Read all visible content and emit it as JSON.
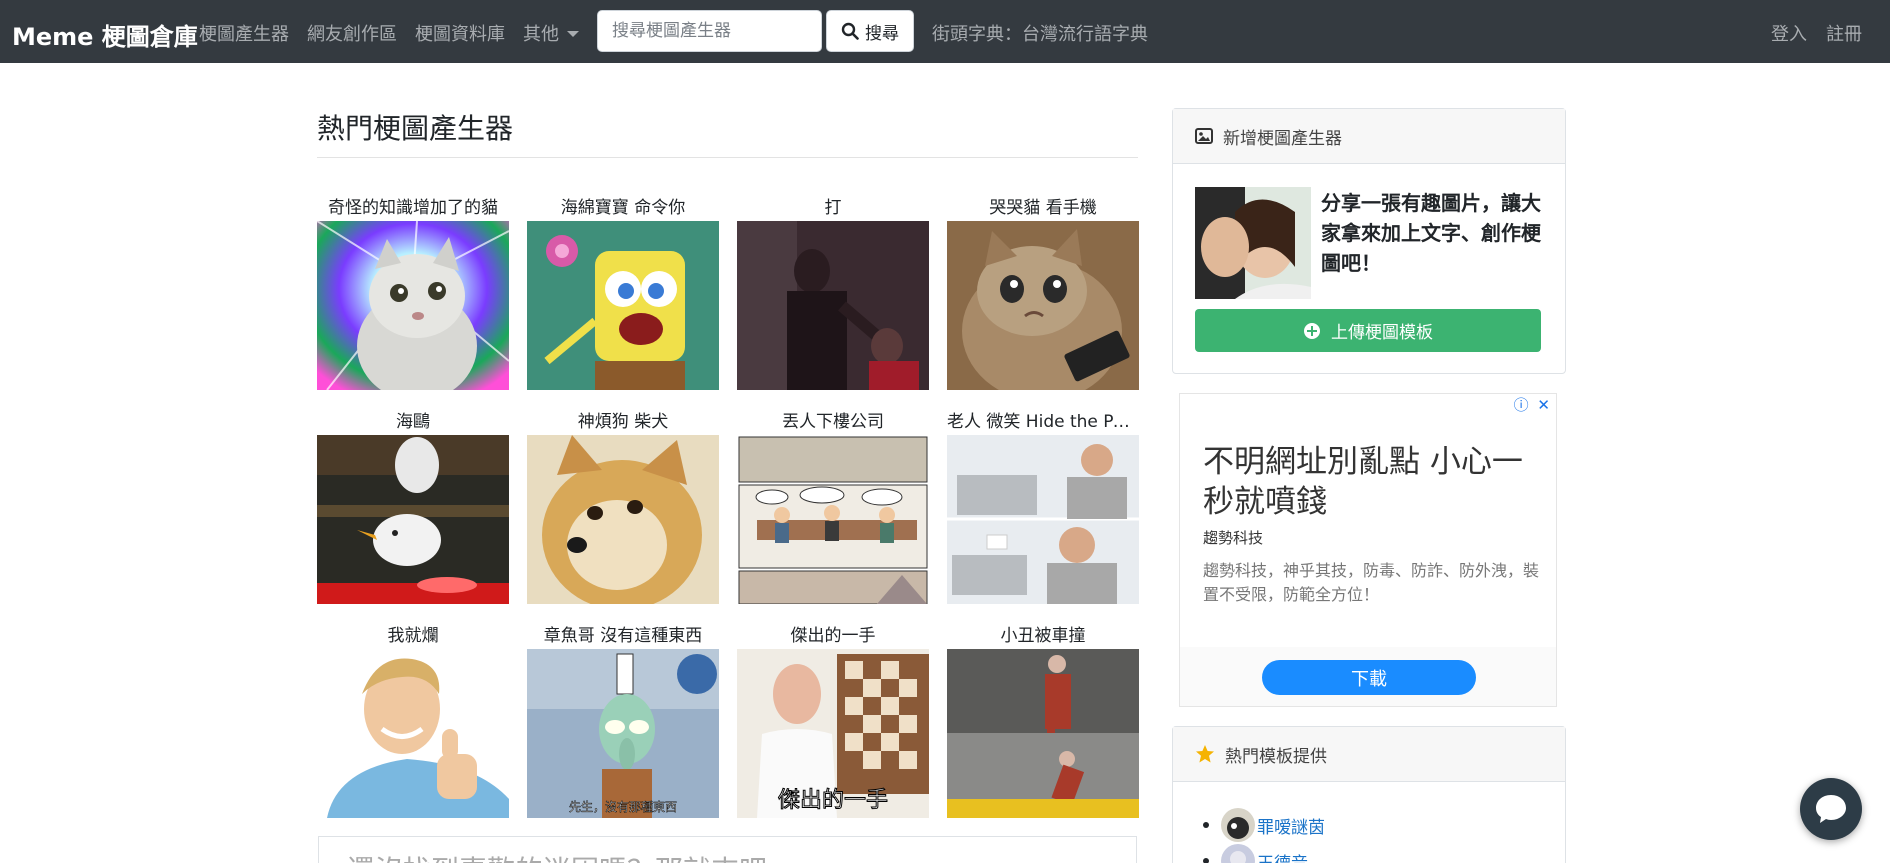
{
  "navbar": {
    "brand": "Meme 梗圖倉庫",
    "links": [
      "梗圖產生器",
      "網友創作區",
      "梗圖資料庫"
    ],
    "dropdown_label": "其他",
    "search_placeholder": "搜尋梗圖產生器",
    "search_button": "搜尋",
    "dictionary_link": "街頭字典：台灣流行語字典",
    "login": "登入",
    "register": "註冊"
  },
  "main": {
    "title": "熱門梗圖產生器",
    "memes": [
      {
        "title": "奇怪的知識增加了的貓",
        "icon": "weird-knowledge-cat"
      },
      {
        "title": "海綿寶寶 命令你",
        "icon": "spongebob-command"
      },
      {
        "title": "打",
        "icon": "slap"
      },
      {
        "title": "哭哭貓 看手機",
        "icon": "crying-cat-phone"
      },
      {
        "title": "海鷗",
        "icon": "seagull"
      },
      {
        "title": "神煩狗 柴犬",
        "icon": "doge"
      },
      {
        "title": "丟人下樓公司",
        "icon": "boardroom"
      },
      {
        "title": "老人 微笑 Hide the Pa...",
        "icon": "hide-the-pain-harold"
      },
      {
        "title": "我就爛",
        "icon": "thumbs-up-guy"
      },
      {
        "title": "章魚哥 沒有這種東西",
        "icon": "squidward"
      },
      {
        "title": "傑出的一手",
        "icon": "chess-master"
      },
      {
        "title": "小丑被車撞",
        "icon": "joker-car"
      }
    ],
    "meme_captions": {
      "squidward": "先生，沒有那種東西",
      "chess": "傑出的一手"
    },
    "bottom_card_text": "還沒找到喜歡的迷因嗎？那就來吧一一"
  },
  "sidebar": {
    "upload_card": {
      "header": "新增梗圖產生器",
      "text": "分享一張有趣圖片，讓大家拿來加上文字、創作梗圖吧！",
      "button": "上傳梗圖模板"
    },
    "ad": {
      "headline": "不明網址別亂點 小心一秒就噴錢",
      "advertiser": "趨勢科技",
      "description": "趨勢科技，神乎其技，防毒、防詐、防外洩，裝置不受限，防範全方位！",
      "button": "下載",
      "info_icon": "ⓘ",
      "close_icon": "✕"
    },
    "contributors_card": {
      "header": "熱門模板提供",
      "contributors": [
        "罪嗳謎茵",
        "王德音"
      ]
    }
  },
  "colors": {
    "navbar_bg": "#343a40",
    "upload_button": "#3cb371",
    "ad_button": "#1a8cff",
    "link": "#1a73c8",
    "star": "#f5b301"
  }
}
